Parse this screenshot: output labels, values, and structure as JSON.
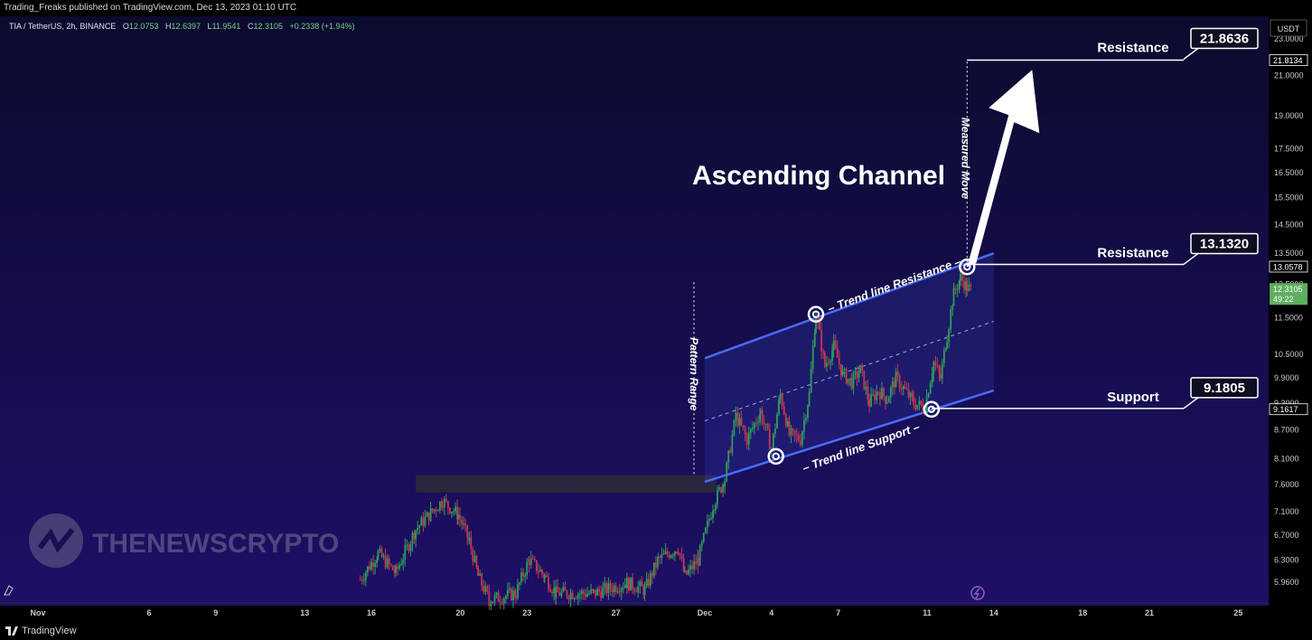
{
  "header": {
    "published": "Trading_Freaks published on TradingView.com, Dec 13, 2023 01:10 UTC"
  },
  "footer": {
    "brand": "TradingView"
  },
  "legend": {
    "symbol": "TIA / TetherUS, 2h, BINANCE",
    "o_label": "O",
    "o_value": "12.0753",
    "h_label": "H",
    "h_value": "12.6397",
    "l_label": "L",
    "l_value": "11.9541",
    "c_label": "C",
    "c_value": "12.3105",
    "change": "+0.2338 (+1.94%)"
  },
  "watermark": "THENEWSCRYPTO",
  "currency": "USDT",
  "colors": {
    "background_top": "#0b0b2e",
    "background_bottom": "#1e0f66",
    "up": "#2e9e5a",
    "down": "#c23a4c",
    "channel": "#4a6cf7",
    "annotation": "#ffffff",
    "last_price": "#5fae5f"
  },
  "chart_data": {
    "type": "candlestick",
    "title": "Ascending Channel",
    "yscale": "log",
    "ylim": [
      5.7,
      24.0
    ],
    "y_ticks": [
      5.96,
      6.3,
      6.7,
      7.1,
      7.6,
      8.1,
      8.7,
      9.3,
      9.9,
      10.5,
      11.5,
      12.5,
      13.5,
      14.5,
      15.5,
      16.5,
      17.5,
      19.0,
      21.0,
      23.0
    ],
    "y_tick_labels": [
      "5.9600",
      "6.3000",
      "6.7000",
      "7.1000",
      "7.6000",
      "8.1000",
      "8.7000",
      "9.3000",
      "9.9000",
      "10.5000",
      "11.5000",
      "12.5000",
      "13.5000",
      "14.5000",
      "15.5000",
      "16.5000",
      "17.5000",
      "19.0000",
      "21.0000",
      "23.0000"
    ],
    "x_ticks": [
      {
        "day": 0,
        "label": "Nov"
      },
      {
        "day": 5,
        "label": "6"
      },
      {
        "day": 8,
        "label": "9"
      },
      {
        "day": 12,
        "label": "13"
      },
      {
        "day": 15,
        "label": "16"
      },
      {
        "day": 19,
        "label": "20"
      },
      {
        "day": 22,
        "label": "23"
      },
      {
        "day": 26,
        "label": "27"
      },
      {
        "day": 30,
        "label": "Dec"
      },
      {
        "day": 33,
        "label": "4"
      },
      {
        "day": 36,
        "label": "7"
      },
      {
        "day": 40,
        "label": "11"
      },
      {
        "day": 43,
        "label": "14"
      },
      {
        "day": 47,
        "label": "18"
      },
      {
        "day": 50,
        "label": "21"
      },
      {
        "day": 54,
        "label": "25"
      }
    ],
    "price_tags": [
      {
        "value": 21.8134,
        "label": "21.8134"
      },
      {
        "value": 13.0578,
        "label": "13.0578"
      },
      {
        "value": 9.1617,
        "label": "9.1617"
      }
    ],
    "last_price": {
      "value": 12.3105,
      "label": "12.3105",
      "countdown": "49:22"
    },
    "candle_anchors": [
      [
        14.5,
        6.0
      ],
      [
        15.3,
        6.4
      ],
      [
        16.1,
        6.1
      ],
      [
        17.0,
        6.8
      ],
      [
        18.2,
        7.3
      ],
      [
        18.9,
        7.05
      ],
      [
        19.4,
        6.6
      ],
      [
        19.8,
        6.05
      ],
      [
        20.3,
        5.7
      ],
      [
        21.5,
        5.8
      ],
      [
        22.1,
        6.3
      ],
      [
        22.8,
        6.05
      ],
      [
        23.3,
        5.8
      ],
      [
        25.0,
        5.8
      ],
      [
        26.5,
        5.95
      ],
      [
        27.3,
        5.85
      ],
      [
        27.9,
        6.3
      ],
      [
        28.8,
        6.5
      ],
      [
        29.1,
        6.05
      ],
      [
        29.7,
        6.3
      ],
      [
        30.4,
        7.25
      ],
      [
        30.9,
        7.7
      ],
      [
        31.4,
        9.0
      ],
      [
        31.9,
        8.5
      ],
      [
        32.5,
        9.1
      ],
      [
        33.0,
        8.3
      ],
      [
        33.4,
        9.5
      ],
      [
        33.8,
        8.6
      ],
      [
        34.3,
        8.5
      ],
      [
        34.7,
        9.5
      ],
      [
        35.0,
        11.6
      ],
      [
        35.4,
        10.2
      ],
      [
        35.8,
        10.7
      ],
      [
        36.2,
        10.0
      ],
      [
        36.6,
        9.8
      ],
      [
        37.0,
        10.1
      ],
      [
        37.4,
        9.3
      ],
      [
        37.8,
        9.6
      ],
      [
        38.2,
        9.4
      ],
      [
        38.6,
        9.9
      ],
      [
        39.0,
        9.6
      ],
      [
        39.4,
        9.3
      ],
      [
        39.9,
        9.2
      ],
      [
        40.3,
        10.3
      ],
      [
        40.6,
        9.9
      ],
      [
        40.9,
        11.0
      ],
      [
        41.2,
        12.2
      ],
      [
        41.5,
        12.7
      ],
      [
        41.8,
        12.4
      ],
      [
        42.0,
        12.3105
      ]
    ],
    "channel": {
      "resistance_line": [
        [
          30.0,
          10.4
        ],
        [
          43.0,
          13.5
        ]
      ],
      "support_line": [
        [
          30.0,
          7.65
        ],
        [
          43.0,
          9.6
        ]
      ],
      "midline": [
        [
          30.0,
          8.9
        ],
        [
          43.0,
          11.4
        ]
      ]
    },
    "touch_points": [
      {
        "day": 35.0,
        "value": 11.6
      },
      {
        "day": 41.8,
        "value": 13.05
      },
      {
        "day": 33.2,
        "value": 8.15
      },
      {
        "day": 40.2,
        "value": 9.16
      }
    ],
    "annotations": {
      "title": "Ascending Channel",
      "trendline_resistance": "– Trend line Resistance –",
      "trendline_support": "– Trend line Support –",
      "pattern_range": "Pattern Range",
      "measured_move": "Measured Move",
      "levels": [
        {
          "label": "Resistance",
          "value": 21.8636,
          "value_label": "21.8636"
        },
        {
          "label": "Resistance",
          "value": 13.132,
          "value_label": "13.1320"
        },
        {
          "label": "Support",
          "value": 9.1805,
          "value_label": "9.1805"
        }
      ]
    },
    "horizontal_zone": {
      "from_day": 17.0,
      "to_day": 30.5,
      "value_low": 7.45,
      "value_high": 7.78
    }
  }
}
